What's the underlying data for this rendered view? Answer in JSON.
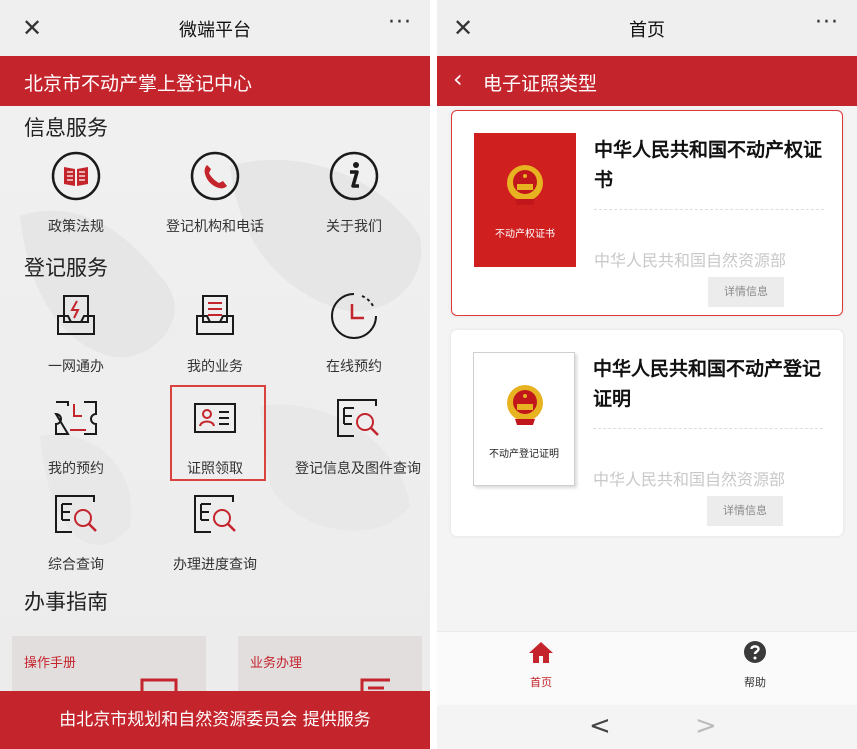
{
  "left": {
    "close_icon": "close-icon",
    "title": "微端平台",
    "more": "···",
    "banner": "北京市不动产掌上登记中心",
    "sections": [
      {
        "title": "信息服务",
        "items": [
          {
            "label": "政策法规",
            "icon": "book-icon"
          },
          {
            "label": "登记机构和电话",
            "icon": "phone-icon"
          },
          {
            "label": "关于我们",
            "icon": "info-icon"
          }
        ]
      },
      {
        "title": "登记服务",
        "items": [
          {
            "label": "一网通办",
            "icon": "inbox-icon"
          },
          {
            "label": "我的业务",
            "icon": "document-tray-icon"
          },
          {
            "label": "在线预约",
            "icon": "clock-icon"
          },
          {
            "label": "我的预约",
            "icon": "ticket-icon"
          },
          {
            "label": "证照领取",
            "icon": "id-card-icon"
          },
          {
            "label": "登记信息及图件查询",
            "icon": "search-document-icon"
          },
          {
            "label": "综合查询",
            "icon": "search-document-icon"
          },
          {
            "label": "办理进度查询",
            "icon": "search-document-icon"
          }
        ]
      },
      {
        "title": "办事指南",
        "cards": [
          {
            "label": "操作手册"
          },
          {
            "label": "业务办理"
          }
        ]
      }
    ],
    "footer": "由北京市规划和自然资源委员会 提供服务"
  },
  "right": {
    "close_icon": "close-icon",
    "title": "首页",
    "more": "···",
    "header": "电子证照类型",
    "cards": [
      {
        "cover_text": "不动产权证书",
        "name": "中华人民共和国不动产权证书",
        "issuer": "中华人民共和国自然资源部",
        "button": "详情信息"
      },
      {
        "cover_text": "不动产登记证明",
        "name": "中华人民共和国不动产登记证明",
        "issuer": "中华人民共和国自然资源部",
        "button": "详情信息"
      }
    ],
    "tabs": [
      {
        "label": "首页",
        "icon": "home-icon",
        "active": true
      },
      {
        "label": "帮助",
        "icon": "help-icon",
        "active": false
      }
    ],
    "nav": {
      "back": "<",
      "forward": ">"
    }
  },
  "colors": {
    "brand_red": "#c4242c",
    "highlight": "#d9423e"
  }
}
